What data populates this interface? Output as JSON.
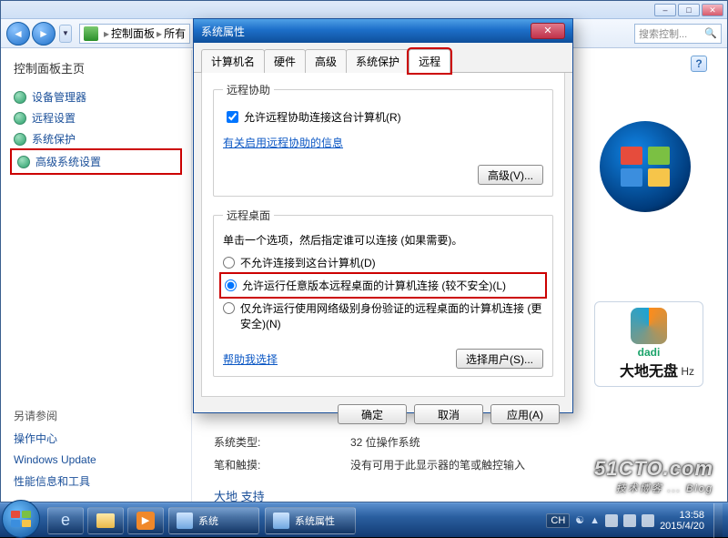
{
  "addr": {
    "part1": "控制面板",
    "part2": "所有",
    "search_placeholder": "搜索控制..."
  },
  "help_glyph": "?",
  "sidebar": {
    "home": "控制面板主页",
    "items": [
      {
        "label": "设备管理器"
      },
      {
        "label": "远程设置"
      },
      {
        "label": "系统保护"
      },
      {
        "label": "高级系统设置"
      }
    ],
    "seealso_header": "另请参阅",
    "seealso": [
      {
        "label": "操作中心"
      },
      {
        "label": "Windows Update"
      },
      {
        "label": "性能信息和工具"
      }
    ]
  },
  "main": {
    "rows": [
      {
        "lab": "系统类型:",
        "val": "32 位操作系统"
      },
      {
        "lab": "笔和触摸:",
        "val": "没有可用于此显示器的笔或触控输入"
      }
    ],
    "section": "大地 支持",
    "hz": "Hz"
  },
  "dadi": {
    "en": "dadi",
    "cn": "大地无盘"
  },
  "dialog": {
    "title": "系统属性",
    "tabs": [
      "计算机名",
      "硬件",
      "高级",
      "系统保护",
      "远程"
    ],
    "active_tab": 4,
    "remote_assist": {
      "legend": "远程协助",
      "checkbox": "允许远程协助连接这台计算机(R)",
      "link": "有关启用远程协助的信息",
      "adv_btn": "高级(V)..."
    },
    "remote_desktop": {
      "legend": "远程桌面",
      "hint": "单击一个选项，然后指定谁可以连接 (如果需要)。",
      "radios": [
        "不允许连接到这台计算机(D)",
        "允许运行任意版本远程桌面的计算机连接 (较不安全)(L)",
        "仅允许运行使用网络级别身份验证的远程桌面的计算机连接 (更安全)(N)"
      ],
      "help_link": "帮助我选择",
      "select_users": "选择用户(S)..."
    },
    "buttons": {
      "ok": "确定",
      "cancel": "取消",
      "apply": "应用(A)"
    }
  },
  "taskbar": {
    "apps": [
      {
        "label": "系统"
      },
      {
        "label": "系统属性"
      }
    ],
    "ime": "CH",
    "time": "13:58",
    "date": "2015/4/20"
  },
  "watermark": {
    "big": "51CTO.com",
    "small": "技术博客 ... Blog"
  }
}
